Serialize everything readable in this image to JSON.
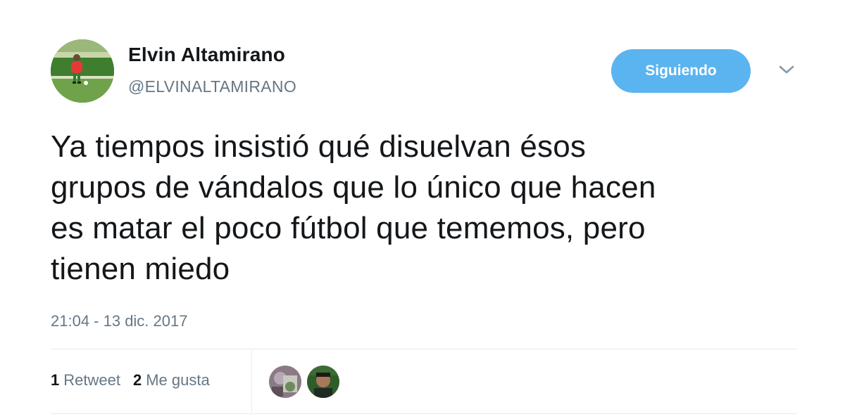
{
  "user": {
    "name": "Elvin Altamirano",
    "handle": "@ELVINALTAMIRANO"
  },
  "follow_button": {
    "label": "Siguiendo"
  },
  "tweet": {
    "lines": [
      "Ya tiempos insistió qué disuelvan ésos",
      "grupos de vándalos que lo único que hacen",
      "es matar el poco fútbol que tememos, pero",
      "tienen miedo"
    ],
    "timestamp": "21:04 - 13 dic. 2017"
  },
  "stats": {
    "retweets": {
      "count": "1",
      "label": "Retweet"
    },
    "likes": {
      "count": "2",
      "label": "Me gusta"
    }
  },
  "colors": {
    "follow_button": "#5ab4ef",
    "secondary_text": "#657786",
    "divider": "#e6ecf0"
  },
  "icons": {
    "menu": "chevron-down-icon"
  }
}
